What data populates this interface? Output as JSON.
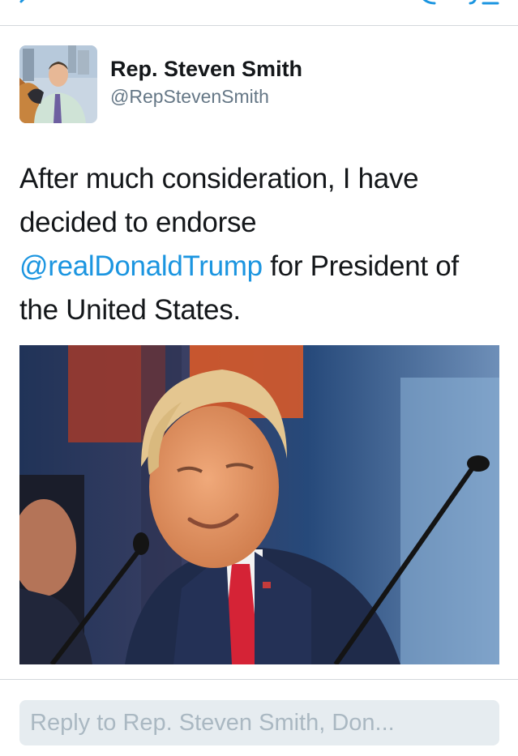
{
  "nav": {
    "back_icon": "chevron-left-icon",
    "reply_icon": "reply-icon",
    "compose_icon": "compose-icon"
  },
  "tweet": {
    "display_name": "Rep. Steven Smith",
    "handle": "@RepStevenSmith",
    "text_before": "After much consideration, I have decided to endorse ",
    "mention": "@realDonaldTrump",
    "text_after": " for President of the United States."
  },
  "reply": {
    "placeholder": "Reply to Rep. Steven Smith, Don..."
  },
  "colors": {
    "link": "#1b95e0",
    "text": "#14171a",
    "secondary": "#657786",
    "reply_bg": "#e6ecf0"
  }
}
